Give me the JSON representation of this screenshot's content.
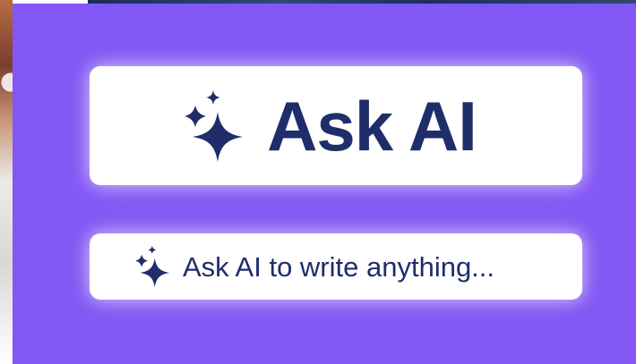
{
  "theme": {
    "panel_color": "#8357f4",
    "button_background": "#ffffff",
    "text_color": "#1f2d6b"
  },
  "primary_action": {
    "label": "Ask AI",
    "icon": "sparkles-icon"
  },
  "secondary_action": {
    "label": "Ask AI to write anything...",
    "icon": "sparkles-icon"
  }
}
